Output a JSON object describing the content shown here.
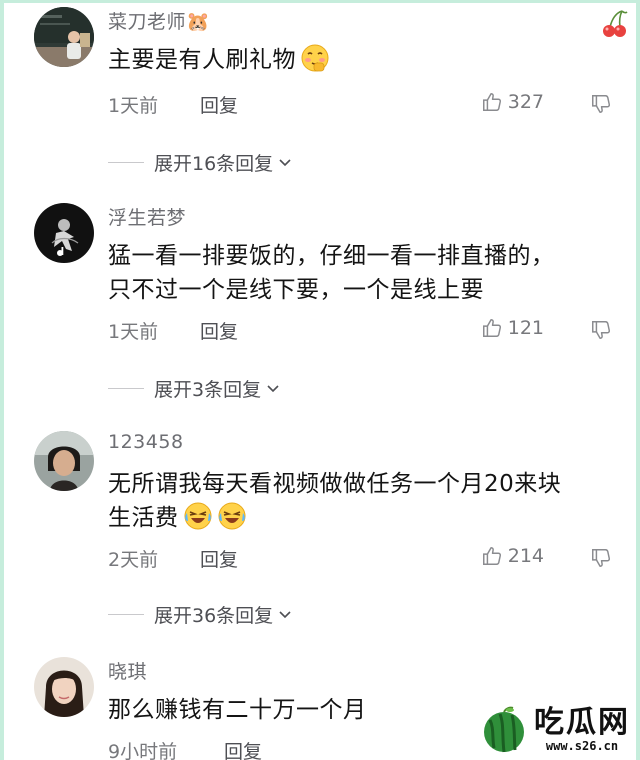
{
  "comments": [
    {
      "username": "菜刀老师🐹",
      "lines": [
        "主要是有人刷礼物"
      ],
      "emoji": "shy-smile",
      "time": "1天前",
      "reply_label": "回复",
      "likes": "327",
      "expand_label": "展开16条回复"
    },
    {
      "username": "浮生若梦",
      "lines": [
        "猛一看一排要饭的，仔细一看一排直播的，",
        "只不过一个是线下要，一个是线上要"
      ],
      "time": "1天前",
      "reply_label": "回复",
      "likes": "121",
      "expand_label": "展开3条回复"
    },
    {
      "username": "123458",
      "lines": [
        "无所谓我每天看视频做做任务一个月20来块",
        "生活费"
      ],
      "emoji": "laugh-cry",
      "time": "2天前",
      "reply_label": "回复",
      "likes": "214",
      "expand_label": "展开36条回复"
    },
    {
      "username": "晓琪",
      "lines": [
        "那么赚钱有二十万一个月"
      ],
      "time": "9小时前",
      "reply_label": "回复"
    }
  ],
  "watermark": {
    "title": "吃瓜网",
    "url": "www.s26.cn"
  },
  "colors": {
    "border": "#c6eddc",
    "meta_text": "#77787c",
    "body_text": "#141414"
  }
}
